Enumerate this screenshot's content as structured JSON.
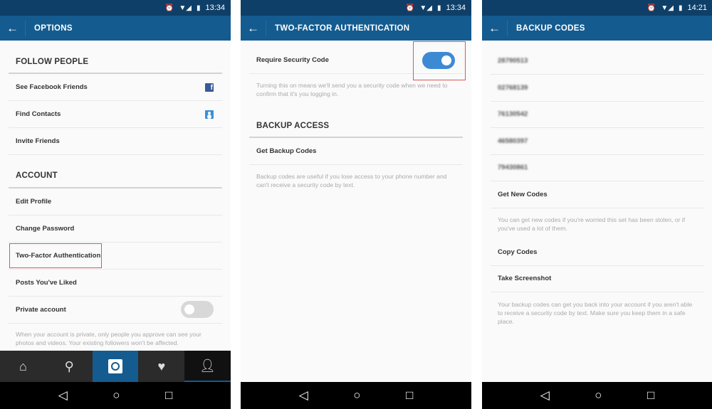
{
  "colors": {
    "status_bar": "#0e3f68",
    "toolbar": "#145b8f",
    "toggle_on": "#3d8ad4",
    "toggle_off": "#d8d8d8",
    "highlight": "#e0555a"
  },
  "panels": [
    {
      "time": "13:34",
      "title": "OPTIONS",
      "follow_header": "FOLLOW PEOPLE",
      "follow_items": [
        "See Facebook Friends",
        "Find Contacts",
        "Invite Friends"
      ],
      "account_header": "ACCOUNT",
      "account_items": [
        "Edit Profile",
        "Change Password",
        "Two-Factor Authentication",
        "Posts You've Liked",
        "Private account"
      ],
      "private_toggle": false,
      "private_desc": "When your account is private, only people you approve can see your photos and videos. Your existing followers won't be affected.",
      "tabs": [
        "home-icon",
        "search-icon",
        "camera-icon",
        "activity-icon",
        "profile-icon"
      ],
      "active_tab": "profile"
    },
    {
      "time": "13:34",
      "title": "TWO-FACTOR AUTHENTICATION",
      "require_label": "Require Security Code",
      "require_toggle": true,
      "require_desc": "Turning this on means we'll send you a security code when we need to confirm that it's you logging in.",
      "backup_header": "BACKUP ACCESS",
      "backup_item": "Get Backup Codes",
      "backup_desc": "Backup codes are useful if you lose access to your phone number and can't receive a security code by text."
    },
    {
      "time": "14:21",
      "title": "BACKUP CODES",
      "codes": [
        "28790513",
        "02768139",
        "76130542",
        "46580397",
        "79430861"
      ],
      "get_new": "Get New Codes",
      "get_new_desc": "You can get new codes if you're worried this set has been stolen, or if you've used a lot of them.",
      "copy": "Copy Codes",
      "screenshot": "Take Screenshot",
      "screenshot_desc": "Your backup codes can get you back into your account if you aren't able to receive a security code by text. Make sure you keep them in a safe place."
    }
  ]
}
